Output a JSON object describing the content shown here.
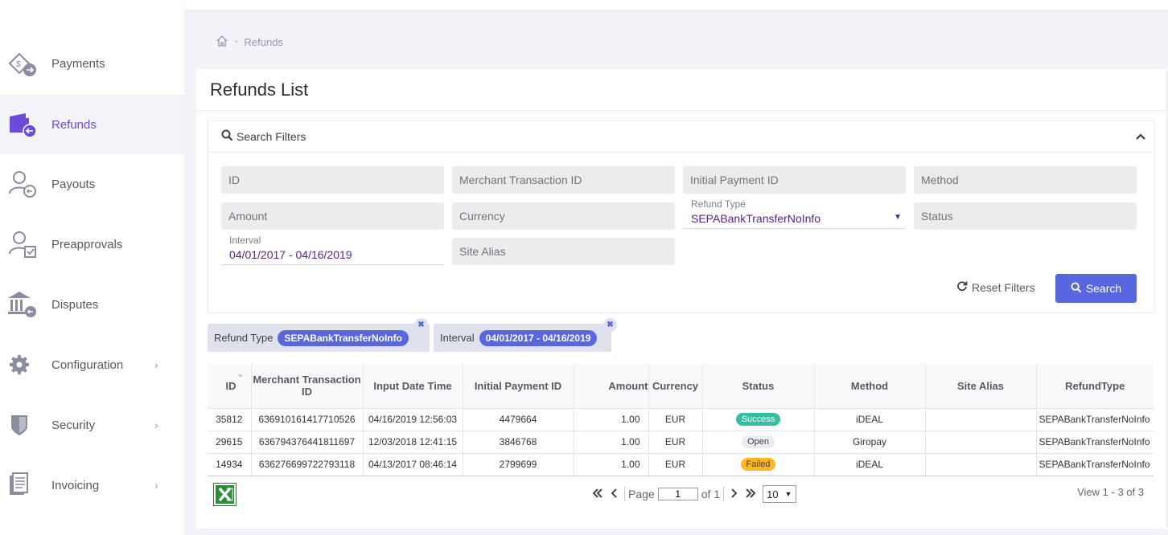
{
  "sidebar": {
    "items": [
      {
        "label": "Payments",
        "icon": "payments-icon"
      },
      {
        "label": "Refunds",
        "icon": "refunds-icon",
        "active": true
      },
      {
        "label": "Payouts",
        "icon": "payouts-icon"
      },
      {
        "label": "Preapprovals",
        "icon": "preapprovals-icon"
      },
      {
        "label": "Disputes",
        "icon": "disputes-icon"
      },
      {
        "label": "Configuration",
        "icon": "gear-icon",
        "chevron": true
      },
      {
        "label": "Security",
        "icon": "shield-icon",
        "chevron": true
      },
      {
        "label": "Invoicing",
        "icon": "document-icon",
        "chevron": true
      }
    ]
  },
  "breadcrumb": {
    "current": "Refunds"
  },
  "page": {
    "title": "Refunds List"
  },
  "filters": {
    "title": "Search Filters",
    "id_placeholder": "ID",
    "merchant_tx_placeholder": "Merchant Transaction ID",
    "initial_payment_placeholder": "Initial Payment ID",
    "method_placeholder": "Method",
    "amount_placeholder": "Amount",
    "currency_placeholder": "Currency",
    "refund_type_label": "Refund Type",
    "refund_type_value": "SEPABankTransferNoInfo",
    "status_placeholder": "Status",
    "interval_label": "Interval",
    "interval_value": "04/01/2017 - 04/16/2019",
    "site_alias_placeholder": "Site Alias",
    "reset_label": "Reset Filters",
    "search_label": "Search"
  },
  "active_filters": [
    {
      "name": "Refund Type",
      "value": "SEPABankTransferNoInfo"
    },
    {
      "name": "Interval",
      "value": "04/01/2017 - 04/16/2019"
    }
  ],
  "table": {
    "columns": [
      "ID",
      "Merchant Transaction ID",
      "Input Date Time",
      "Initial Payment ID",
      "Amount",
      "Currency",
      "Status",
      "Method",
      "Site Alias",
      "RefundType"
    ],
    "rows": [
      {
        "id": "35812",
        "merchant_tx": "636910161417710526",
        "date": "04/16/2019 12:56:03",
        "initial_payment": "4479664",
        "amount": "1.00",
        "currency": "EUR",
        "status": "Success",
        "method": "iDEAL",
        "site_alias": "",
        "refund_type": "SEPABankTransferNoInfo"
      },
      {
        "id": "29615",
        "merchant_tx": "636794376441811697",
        "date": "12/03/2018 12:41:15",
        "initial_payment": "3846768",
        "amount": "1.00",
        "currency": "EUR",
        "status": "Open",
        "method": "Giropay",
        "site_alias": "",
        "refund_type": "SEPABankTransferNoInfo"
      },
      {
        "id": "14934",
        "merchant_tx": "636276699722793118",
        "date": "04/13/2017 08:46:14",
        "initial_payment": "2799699",
        "amount": "1.00",
        "currency": "EUR",
        "status": "Failed",
        "method": "iDEAL",
        "site_alias": "",
        "refund_type": "SEPABankTransferNoInfo"
      }
    ]
  },
  "status_colors": {
    "Success": "#34bfa3",
    "Open": "#ebedf2",
    "Failed": "#ffb822"
  },
  "pager": {
    "page_label": "Page",
    "page_value": "1",
    "of_label": "of 1",
    "page_size": "10",
    "view_info": "View 1 - 3 of 3"
  },
  "colors": {
    "accent": "#5867dd",
    "active_nav": "#6c4bd8",
    "interval_text": "#5b1f88"
  }
}
